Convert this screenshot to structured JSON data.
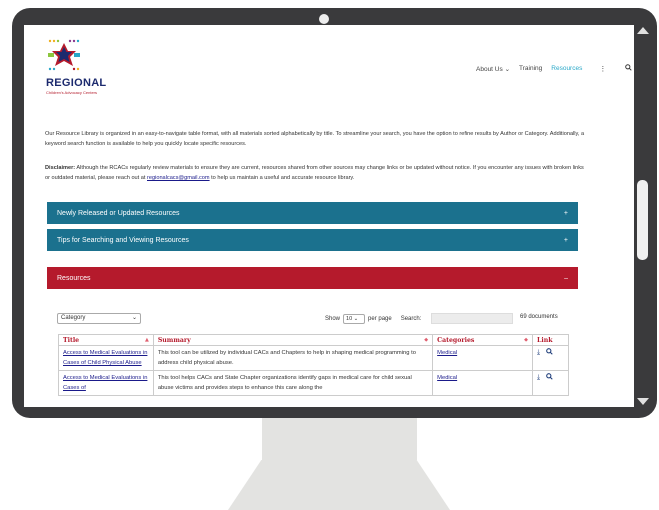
{
  "brand": {
    "logo_text": "REGIONAL",
    "logo_sub": "Children's Advocacy Centers",
    "colors": {
      "navy": "#1c2a6e",
      "red": "#b51a2c",
      "teal": "#1b718e",
      "accent": "#2aa8c8"
    }
  },
  "nav": {
    "items": [
      {
        "label": "About Us",
        "has_dropdown": true
      },
      {
        "label": "Training"
      },
      {
        "label": "Resources",
        "active": true
      }
    ],
    "more_icon": "kebab-icon",
    "search_icon": "search-icon"
  },
  "intro_text": "Our Resource Library is organized in an easy-to-navigate table format, with all materials sorted alphabetically by title. To streamline your search, you have the option to refine results by Author or Category. Additionally, a keyword search function is available to help you quickly locate specific resources.",
  "disclaimer": {
    "label": "Disclaimer:",
    "text_before": " Although the RCACs regularly review materials to ensure they are current, resources shared from other sources may change links or be updated without notice. If you encounter any issues with broken links or outdated material, please reach out at ",
    "email": "regionalcacs@gmail.com",
    "text_after": " to help us maintain a useful and accurate resource library."
  },
  "accordions": [
    {
      "label": "Newly Released or Updated Resources",
      "toggle": "+"
    },
    {
      "label": "Tips for Searching and Viewing Resources",
      "toggle": "+"
    },
    {
      "label": "Resources",
      "toggle": "–"
    }
  ],
  "controls": {
    "category_label": "Category",
    "show_label": "Show",
    "per_page_value": "10",
    "per_page_label": "per page",
    "search_label": "Search:",
    "doc_count": "69 documents"
  },
  "table": {
    "headers": [
      "Title",
      "Summary",
      "Categories",
      "Link"
    ],
    "rows": [
      {
        "title": "Access to Medical Evaluations in Cases of Child Physical Abuse",
        "summary": "This tool can be utilized by individual CACs and Chapters to help in shaping medical programming to address child physical abuse.",
        "category": "Medical"
      },
      {
        "title": "Access to Medical Evaluations in Cases of",
        "summary": "This tool helps CACs and State Chapter organizations identify gaps in medical care for child sexual abuse victims and provides steps to enhance this care along the",
        "category": "Medical"
      }
    ]
  }
}
